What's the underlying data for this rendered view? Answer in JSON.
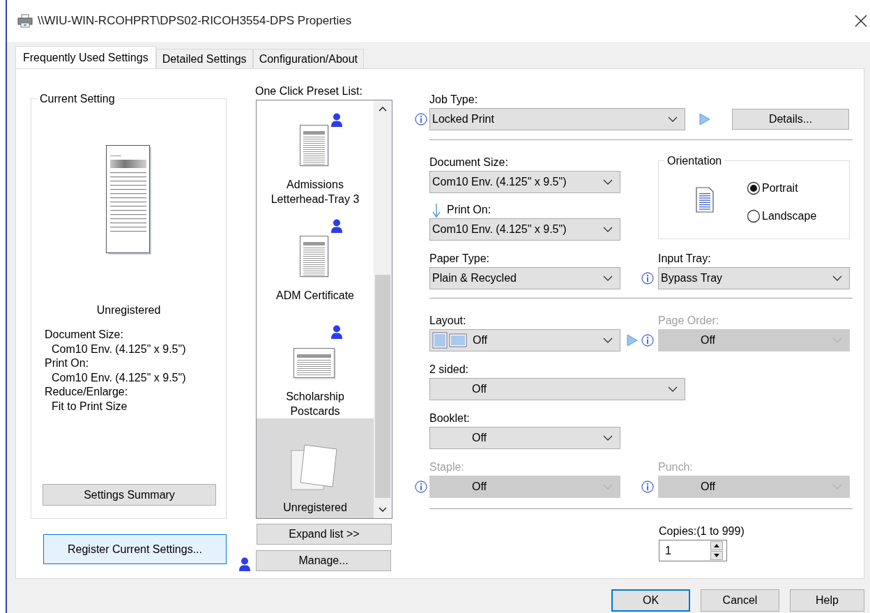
{
  "window": {
    "title": "\\\\WIU-WIN-RCOHPRT\\DPS02-RICOH3554-DPS Properties"
  },
  "tabs": [
    {
      "label": "Frequently Used Settings",
      "selected": true
    },
    {
      "label": "Detailed Settings",
      "selected": false
    },
    {
      "label": "Configuration/About",
      "selected": false
    }
  ],
  "current_setting": {
    "title": "Current Setting",
    "preset_name": "Unregistered",
    "details": [
      {
        "label": "Document Size:",
        "value": "Com10 Env. (4.125\" x 9.5\")"
      },
      {
        "label": "Print On:",
        "value": "Com10 Env. (4.125\" x 9.5\")"
      },
      {
        "label": "Reduce/Enlarge:",
        "value": "Fit to Print Size"
      }
    ],
    "summary_button": "Settings Summary"
  },
  "register_button": "Register Current Settings...",
  "preset_list": {
    "label": "One Click Preset List:",
    "items": [
      {
        "name": "Admissions Letterhead-Tray 3",
        "kind": "portrait",
        "user": true,
        "selected": false
      },
      {
        "name": "ADM Certificate",
        "kind": "portrait",
        "user": true,
        "selected": false
      },
      {
        "name": "Scholarship Postcards",
        "kind": "landscape",
        "user": true,
        "selected": false
      },
      {
        "name": "Unregistered",
        "kind": "blank",
        "user": false,
        "selected": true
      }
    ],
    "expand_button": "Expand list >>",
    "manage_button": "Manage..."
  },
  "settings": {
    "job_type": {
      "label": "Job Type:",
      "value": "Locked Print",
      "disabled": false,
      "info": true
    },
    "details_button": "Details...",
    "document_size": {
      "label": "Document Size:",
      "value": "Com10 Env. (4.125\" x 9.5\")",
      "disabled": false,
      "info": false
    },
    "print_on": {
      "label": "Print On:",
      "value": "Com10 Env. (4.125\" x 9.5\")",
      "disabled": false,
      "info": false
    },
    "paper_type": {
      "label": "Paper Type:",
      "value": "Plain & Recycled",
      "disabled": false,
      "info": false
    },
    "input_tray": {
      "label": "Input Tray:",
      "value": "Bypass Tray",
      "disabled": false,
      "info": true
    },
    "layout": {
      "label": "Layout:",
      "value": "Off",
      "disabled": false,
      "info": false
    },
    "page_order": {
      "label": "Page Order:",
      "value": "Off",
      "disabled": true,
      "info": true
    },
    "two_sided": {
      "label": "2 sided:",
      "value": "Off",
      "disabled": false,
      "info": false
    },
    "booklet": {
      "label": "Booklet:",
      "value": "Off",
      "disabled": false,
      "info": false
    },
    "staple": {
      "label": "Staple:",
      "value": "Off",
      "disabled": true,
      "info": true
    },
    "punch": {
      "label": "Punch:",
      "value": "Off",
      "disabled": true,
      "info": true
    }
  },
  "orientation": {
    "title": "Orientation",
    "options": [
      {
        "label": "Portrait",
        "selected": true
      },
      {
        "label": "Landscape",
        "selected": false
      }
    ]
  },
  "copies": {
    "label": "Copies:(1 to 999)",
    "value": "1"
  },
  "buttons": [
    {
      "label": "OK",
      "default": true
    },
    {
      "label": "Cancel",
      "default": false
    },
    {
      "label": "Help",
      "default": false
    }
  ]
}
